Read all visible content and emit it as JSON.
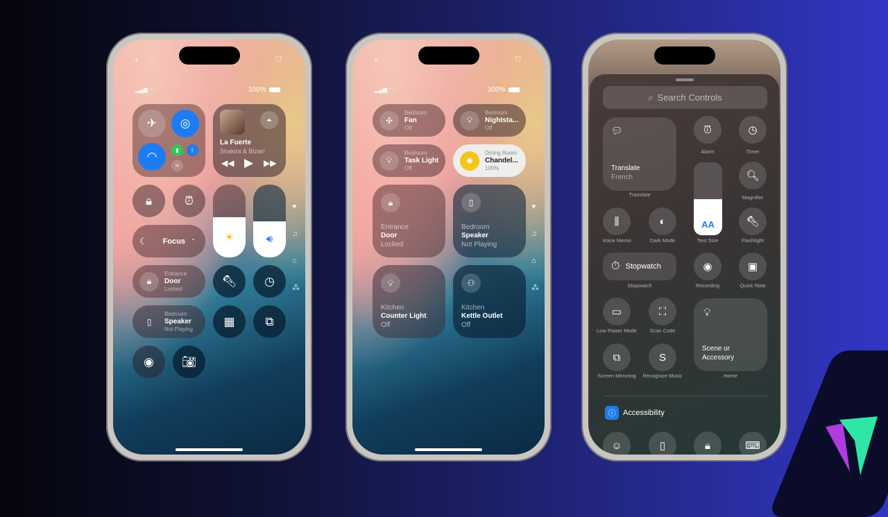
{
  "status": {
    "battery": "100%"
  },
  "phone1": {
    "media": {
      "title": "La Fuerte",
      "artist": "Shakira & Bizarr"
    },
    "focus": {
      "label": "Focus"
    },
    "door": {
      "room": "Entrance",
      "name": "Door",
      "state": "Locked"
    },
    "speaker": {
      "room": "Bedroom",
      "name": "Speaker",
      "state": "Not Playing"
    },
    "levels": {
      "brightness_pct": 45,
      "volume_pct": 50
    }
  },
  "phone2": {
    "tiles": [
      {
        "room": "Bedroom",
        "name": "Fan",
        "state": "Off"
      },
      {
        "room": "Bedroom",
        "name": "Nightsta...",
        "state": "Off"
      },
      {
        "room": "Bedroom",
        "name": "Task Light",
        "state": "Off"
      },
      {
        "room": "Dining Room",
        "name": "Chandel...",
        "state": "100%"
      },
      {
        "room": "Entrance",
        "name": "Door",
        "state": "Locked"
      },
      {
        "room": "Bedroom",
        "name": "Speaker",
        "state": "Not Playing"
      },
      {
        "room": "Kitchen",
        "name": "Counter Light",
        "state": "Off"
      },
      {
        "room": "Kitchen",
        "name": "Kettle Outlet",
        "state": "Off"
      }
    ]
  },
  "phone3": {
    "search_placeholder": "Search Controls",
    "translate": {
      "title": "Translate",
      "subtitle": "French",
      "label": "Translate"
    },
    "stopwatch": {
      "title": "Stopwatch",
      "label": "Stopwatch"
    },
    "home": {
      "title": "Scene or Accessory",
      "label": "Home"
    },
    "text_size_icon": "AA",
    "labels": {
      "alarm": "Alarm",
      "timer": "Timer",
      "magnifier": "Magnifier",
      "voice_memo": "Voice Memo",
      "dark_mode": "Dark Mode",
      "text_size": "Text Size",
      "flashlight": "Flashlight",
      "recording": "Recording",
      "quick_note": "Quick Note",
      "low_power": "Low Power Mode",
      "scan_code": "Scan Code",
      "screen_mirroring": "Screen Mirroring",
      "recognize_music": "Recognize Music"
    },
    "section": "Accessibility"
  },
  "colors": {
    "accent_blue": "#1e7cf2",
    "green": "#34c759",
    "chandelier": "#f5c518",
    "bg_right": "#3236c4"
  }
}
